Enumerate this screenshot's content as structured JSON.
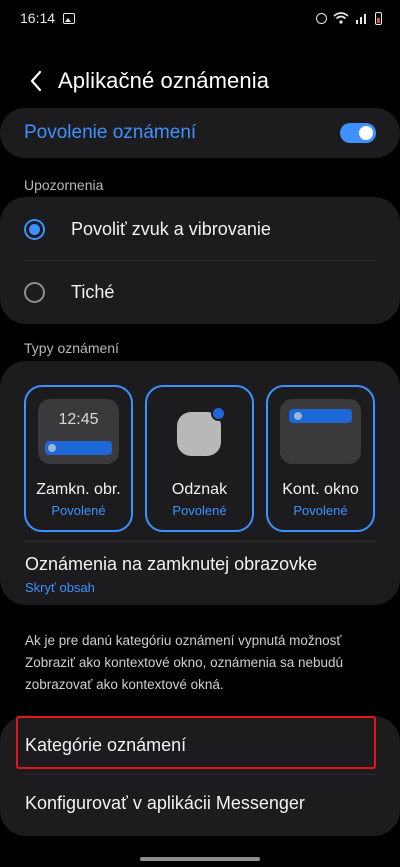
{
  "status_bar": {
    "time": "16:14",
    "icons": [
      "gallery-icon",
      "alarm-icon",
      "wifi-icon",
      "signal-icon",
      "battery-icon"
    ],
    "battery_color": "#e04b3b"
  },
  "header": {
    "back_icon": "chevron-left-icon",
    "title": "Aplikačné oznámenia"
  },
  "master_toggle": {
    "label": "Povolenie oznámení",
    "state": "on"
  },
  "alerts": {
    "section_label": "Upozornenia",
    "options": [
      {
        "label": "Povoliť zvuk a vibrovanie",
        "selected": true
      },
      {
        "label": "Tiché",
        "selected": false
      }
    ]
  },
  "types": {
    "section_label": "Typy oznámení",
    "tiles": [
      {
        "label": "Zamkn. obr.",
        "status": "Povolené",
        "preview_time": "12:45"
      },
      {
        "label": "Odznak",
        "status": "Povolené"
      },
      {
        "label": "Kont. okno",
        "status": "Povolené"
      }
    ],
    "lock_screen": {
      "title": "Oznámenia na zamknutej obrazovke",
      "subtitle": "Skryť obsah"
    }
  },
  "info_text": "Ak je pre danú kategóriu oznámení vypnutá možnosť Zobraziť ako kontextové okno, oznámenia sa nebudú zobrazovať ako kontextové okná.",
  "bottom_list": {
    "items": [
      {
        "label": "Kategórie oznámení",
        "highlighted": true
      },
      {
        "label": "Konfigurovať v aplikácii Messenger"
      }
    ]
  },
  "colors": {
    "accent": "#3e91ff",
    "background": "#000000",
    "card": "#1c1c1e",
    "highlight_border": "#e21818"
  }
}
